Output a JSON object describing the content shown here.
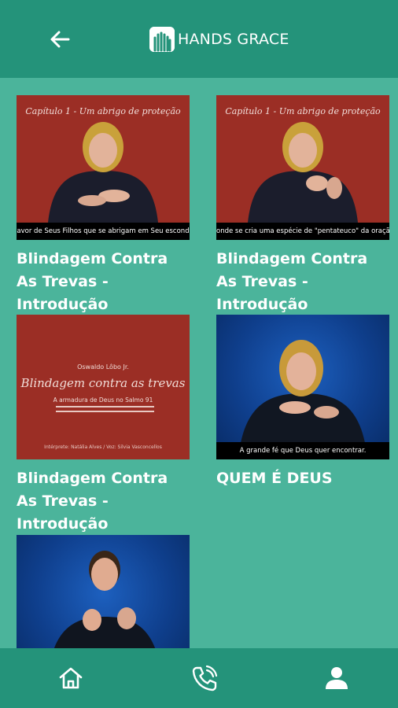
{
  "header": {
    "brand": "HANDS GRACE",
    "back_icon": "arrow-left-icon",
    "logo_icon": "hands-logo-icon"
  },
  "videos": [
    {
      "title": "Blindagem Contra As Trevas - Introdução",
      "thumb_heading": "Capítulo 1 - Um abrigo de proteção",
      "thumb_caption": "avor de Seus Filhos que se abrigam em Seu escond"
    },
    {
      "title": "Blindagem Contra As Trevas - Introdução",
      "thumb_heading": "Capítulo 1 - Um abrigo de proteção",
      "thumb_caption": "onde se cria uma espécie de \"pentateuco\" da oração"
    },
    {
      "title": "Blindagem Contra As Trevas - Introdução",
      "thumb_author": "Oswaldo Lôbo Jr.",
      "thumb_heading": "Blindagem contra as trevas",
      "thumb_subtitle": "A armadura de Deus no Salmo 91",
      "thumb_credits": "Intérprete: Natália Alves    /    Voz: Silvia Vasconcellos"
    },
    {
      "title": "QUEM É DEUS",
      "thumb_caption": "A grande fé que Deus quer encontrar."
    },
    {
      "title": ""
    }
  ],
  "bottom_nav": {
    "items": [
      "home-icon",
      "phone-icon",
      "user-icon"
    ]
  },
  "colors": {
    "primary": "#24937a",
    "background": "#4bb49b",
    "thumb_red": "#9b2e25",
    "thumb_blue": "#1d60bf"
  }
}
